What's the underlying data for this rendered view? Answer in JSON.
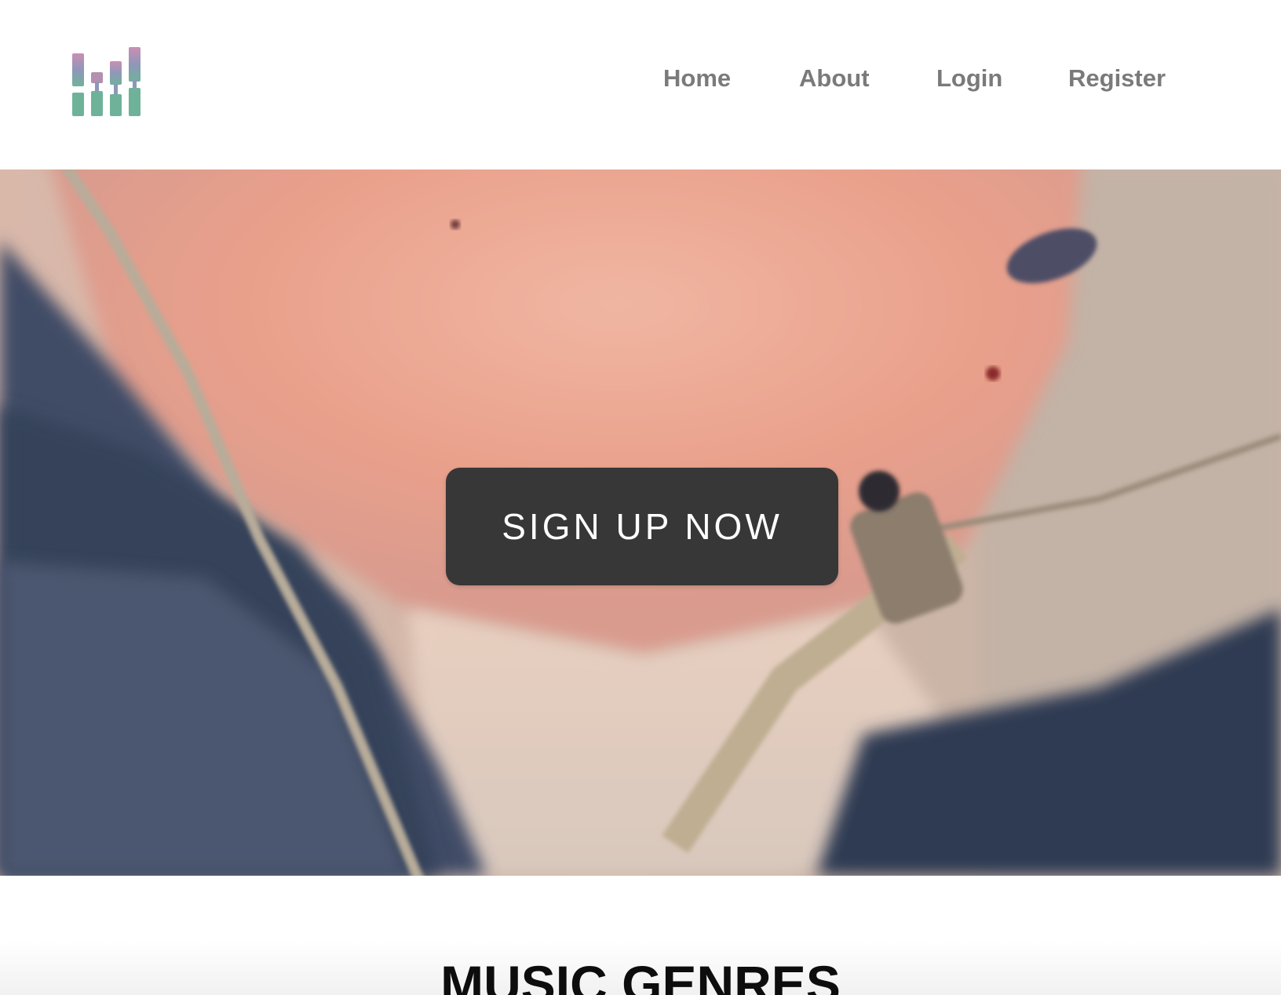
{
  "nav": {
    "home": "Home",
    "about": "About",
    "login": "Login",
    "register": "Register"
  },
  "hero": {
    "cta_label": "SIGN UP NOW"
  },
  "genres": {
    "title": "MUSIC GENRES"
  },
  "logo": {
    "icon": "equalizer-bars-icon",
    "colors": [
      "#c98fb5",
      "#8f97b8",
      "#6fb29a"
    ]
  },
  "colors": {
    "nav_text": "#7a7a7a",
    "cta_bg": "#373737",
    "cta_text": "#ffffff",
    "heading": "#0d0d0d"
  }
}
